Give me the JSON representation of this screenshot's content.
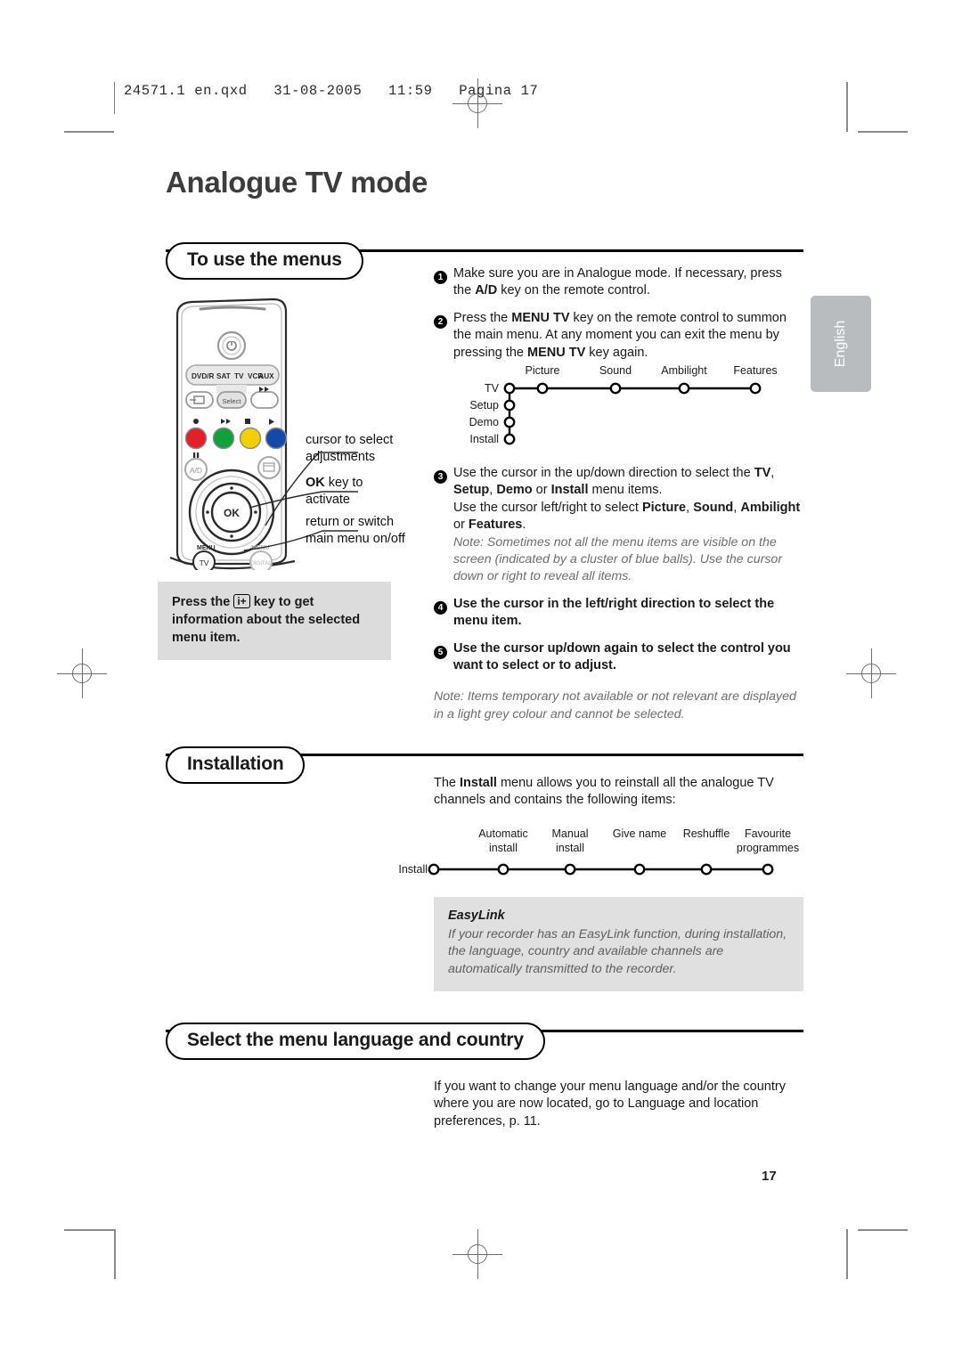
{
  "print": {
    "slug": "24571.1 en.qxd   31-08-2005   11:59   Pagina 17",
    "page_number": "17"
  },
  "page": {
    "title": "Analogue TV mode",
    "language_tab": "English"
  },
  "sections": [
    {
      "id": "to-use-the-menus",
      "title": "To use the menus"
    },
    {
      "id": "installation",
      "title": "Installation"
    },
    {
      "id": "select-language",
      "title": "Select the menu language and country"
    }
  ],
  "menus_section": {
    "steps": [
      {
        "num": "1",
        "bold": false,
        "parts": [
          {
            "t": "Make sure you are in Analogue mode. If necessary, press the ",
            "b": false
          },
          {
            "t": "A/D",
            "b": true
          },
          {
            "t": " key on the remote control.",
            "b": false
          }
        ]
      },
      {
        "num": "2",
        "bold": false,
        "parts": [
          {
            "t": "Press the ",
            "b": false
          },
          {
            "t": "MENU TV",
            "b": true
          },
          {
            "t": " key on the remote control to summon the main menu. At any moment you can exit the menu by pressing the ",
            "b": false
          },
          {
            "t": "MENU TV",
            "b": true
          },
          {
            "t": " key again.",
            "b": false
          }
        ]
      }
    ],
    "steps_after_tree": [
      {
        "num": "3",
        "bold": false,
        "parts": [
          {
            "t": "Use the cursor in the up/down direction to select the ",
            "b": false
          },
          {
            "t": "TV",
            "b": true
          },
          {
            "t": ", ",
            "b": false
          },
          {
            "t": "Setup",
            "b": true
          },
          {
            "t": ", ",
            "b": false
          },
          {
            "t": "Demo",
            "b": true
          },
          {
            "t": " or ",
            "b": false
          },
          {
            "t": "Install",
            "b": true
          },
          {
            "t": " menu items.",
            "b": false
          },
          {
            "t": "\nUse the cursor left/right to select ",
            "b": false
          },
          {
            "t": "Picture",
            "b": true
          },
          {
            "t": ", ",
            "b": false
          },
          {
            "t": "Sound",
            "b": true
          },
          {
            "t": ", ",
            "b": false
          },
          {
            "t": "Ambilight",
            "b": true
          },
          {
            "t": " or ",
            "b": false
          },
          {
            "t": "Features",
            "b": true
          },
          {
            "t": ".",
            "b": false
          }
        ],
        "note": "Note: Sometimes not all the menu items are visible on the screen  (indicated by a cluster of blue balls). Use the cursor down or right to reveal all items."
      },
      {
        "num": "4",
        "bold": true,
        "parts": [
          {
            "t": "Use the cursor in the left/right direction to select the menu item.",
            "b": false
          }
        ]
      },
      {
        "num": "5",
        "bold": true,
        "parts": [
          {
            "t": "Use the cursor up/down again to select the control you want to select or to adjust.",
            "b": false
          }
        ]
      }
    ],
    "closing_note": "Note: Items temporary not available or not relevant are displayed in a light grey colour and cannot be selected.",
    "info_box": {
      "before": "Press the ",
      "key": "i+",
      "after": " key to get information about the selected menu item."
    }
  },
  "menu_tree": {
    "root_label": "TV",
    "vertical_items": [
      "TV",
      "Setup",
      "Demo",
      "Install"
    ],
    "horizontal_items": [
      "Picture",
      "Sound",
      "Ambilight",
      "Features"
    ]
  },
  "installation_section": {
    "intro_parts": [
      {
        "t": "The ",
        "b": false
      },
      {
        "t": "Install",
        "b": true
      },
      {
        "t": " menu allows you to reinstall all the analogue TV channels and contains the following items:",
        "b": false
      }
    ],
    "tree": {
      "root_label": "Install",
      "items": [
        [
          "Automatic",
          "install"
        ],
        [
          "Manual",
          "install"
        ],
        [
          "Give name",
          ""
        ],
        [
          "Reshuffle",
          ""
        ],
        [
          "Favourite",
          "programmes"
        ]
      ]
    },
    "easylink": {
      "title": "EasyLink",
      "body": "If your recorder has an EasyLink function, during installation, the language, country and available channels are automatically transmitted to the recorder."
    }
  },
  "language_section": {
    "body": "If you want to change your menu language and/or the country where you are now located, go to Language and location preferences, p. 11."
  },
  "remote": {
    "power_icon": "power-icon",
    "source_row": [
      "DVD/R",
      "SAT",
      "TV",
      "VCR",
      "AUX"
    ],
    "select_label": "Select",
    "color_keys": [
      "#e3202a",
      "#10a13b",
      "#f2d000",
      "#1549a8"
    ],
    "ad_label": "A/D",
    "ok_label": "OK",
    "menu_tv_label": "MENU",
    "menu_tv_sub": "TV",
    "menu_digital_label": "MENU",
    "menu_digital_sub": "DIGITAL",
    "callouts": [
      {
        "id": "cursor",
        "line1": "cursor to select",
        "line2": "adjustments"
      },
      {
        "id": "ok",
        "bold": "OK",
        "rest": " key to",
        "line2": "activate"
      },
      {
        "id": "menu",
        "line1": "return or switch",
        "line2": "main menu on/off"
      }
    ]
  }
}
